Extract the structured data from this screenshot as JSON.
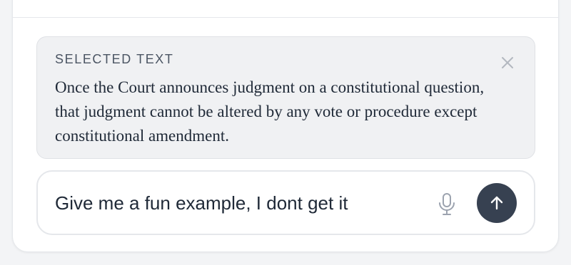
{
  "selection": {
    "label": "SELECTED TEXT",
    "text": "Once the Court announces judgment on a constitutional question, that judgment cannot be altered by any vote or procedure except constitutional amendment.",
    "close_icon": "close-icon"
  },
  "composer": {
    "value": "Give me a fun example, I dont get it",
    "mic_icon": "microphone-icon",
    "send_icon": "arrow-up-icon"
  },
  "colors": {
    "send_button": "#374151",
    "card_background": "#f0f1f3",
    "text": "#1f2937"
  }
}
